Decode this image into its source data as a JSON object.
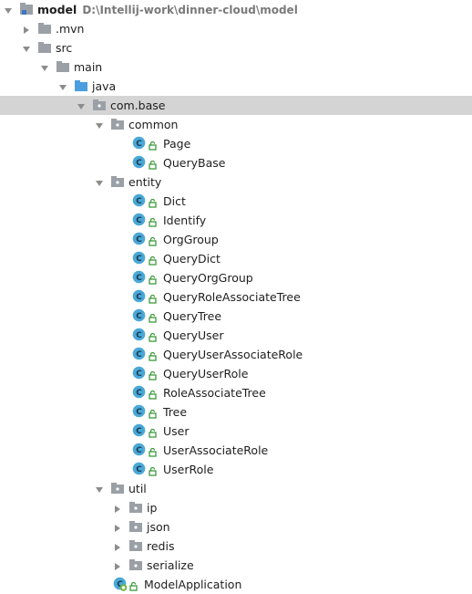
{
  "tree": {
    "root": {
      "label": "model",
      "path": "D:\\Intellij-work\\dinner-cloud\\model",
      "expanded": true
    },
    "mvn": {
      "label": ".mvn",
      "expanded": false
    },
    "src": {
      "label": "src",
      "expanded": true
    },
    "main": {
      "label": "main",
      "expanded": true
    },
    "java": {
      "label": "java",
      "expanded": true
    },
    "com_base": {
      "label": "com.base",
      "expanded": true,
      "selected": true
    },
    "common": {
      "label": "common",
      "expanded": true,
      "classes": [
        "Page",
        "QueryBase"
      ]
    },
    "entity": {
      "label": "entity",
      "expanded": true,
      "classes": [
        "Dict",
        "Identify",
        "OrgGroup",
        "QueryDict",
        "QueryOrgGroup",
        "QueryRoleAssociateTree",
        "QueryTree",
        "QueryUser",
        "QueryUserAssociateRole",
        "QueryUserRole",
        "RoleAssociateTree",
        "Tree",
        "User",
        "UserAssociateRole",
        "UserRole"
      ]
    },
    "util": {
      "label": "util",
      "expanded": true,
      "children": [
        "ip",
        "json",
        "redis",
        "serialize"
      ]
    },
    "app": {
      "label": "ModelApplication"
    }
  },
  "colors": {
    "selection": "#d4d4d4",
    "class_icon": "#4aa8d6",
    "folder_gray": "#9aa0a6",
    "folder_source": "#4a9ede",
    "access_green": "#3c9a3c",
    "path_gray": "#7a7a7a"
  },
  "icons": {
    "class": "java-class-icon",
    "package": "package-icon",
    "folder": "folder-icon",
    "source_folder": "source-folder-icon",
    "module": "module-icon",
    "spring_boot": "spring-boot-app-icon",
    "access": "public-access-icon"
  }
}
